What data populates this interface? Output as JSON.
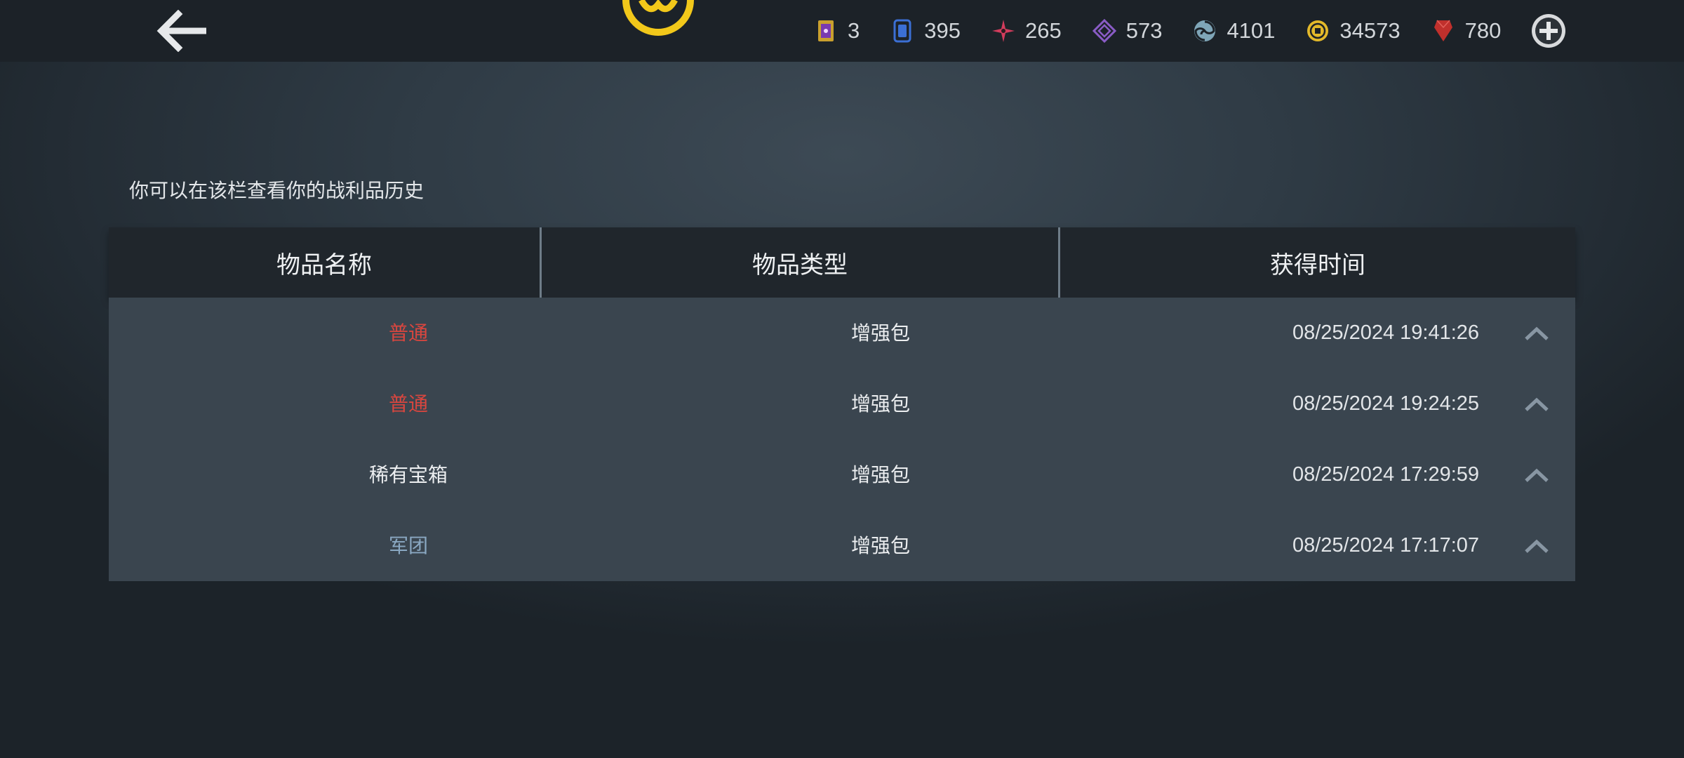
{
  "header": {
    "currencies": [
      {
        "icon": "ticket-icon",
        "value": "3",
        "color": "#c9a02e"
      },
      {
        "icon": "card-icon",
        "value": "395",
        "color": "#3b6fd4"
      },
      {
        "icon": "red-star-icon",
        "value": "265",
        "color": "#d23c5c"
      },
      {
        "icon": "purple-diamond-icon",
        "value": "573",
        "color": "#8a5cc6"
      },
      {
        "icon": "spiral-icon",
        "value": "4101",
        "color": "#7fa6b8"
      },
      {
        "icon": "coin-icon",
        "value": "34573",
        "color": "#e3b92a"
      },
      {
        "icon": "ruby-icon",
        "value": "780",
        "color": "#c0302c"
      }
    ]
  },
  "page": {
    "subtitle": "你可以在该栏查看你的战利品历史"
  },
  "table": {
    "headers": [
      "物品名称",
      "物品类型",
      "获得时间"
    ],
    "rows": [
      {
        "name": "普通",
        "name_color": "red",
        "type": "增强包",
        "time": "08/25/2024 19:41:26"
      },
      {
        "name": "普通",
        "name_color": "red",
        "type": "增强包",
        "time": "08/25/2024 19:24:25"
      },
      {
        "name": "稀有宝箱",
        "name_color": "white",
        "type": "增强包",
        "time": "08/25/2024 17:29:59"
      },
      {
        "name": "军团",
        "name_color": "blue",
        "type": "增强包",
        "time": "08/25/2024 17:17:07"
      }
    ]
  },
  "colors": {
    "topbar": "#1c2228",
    "accent_yellow": "#f2c81a",
    "rarity_red": "#d9463f",
    "rarity_blue": "#8aa8c2"
  }
}
